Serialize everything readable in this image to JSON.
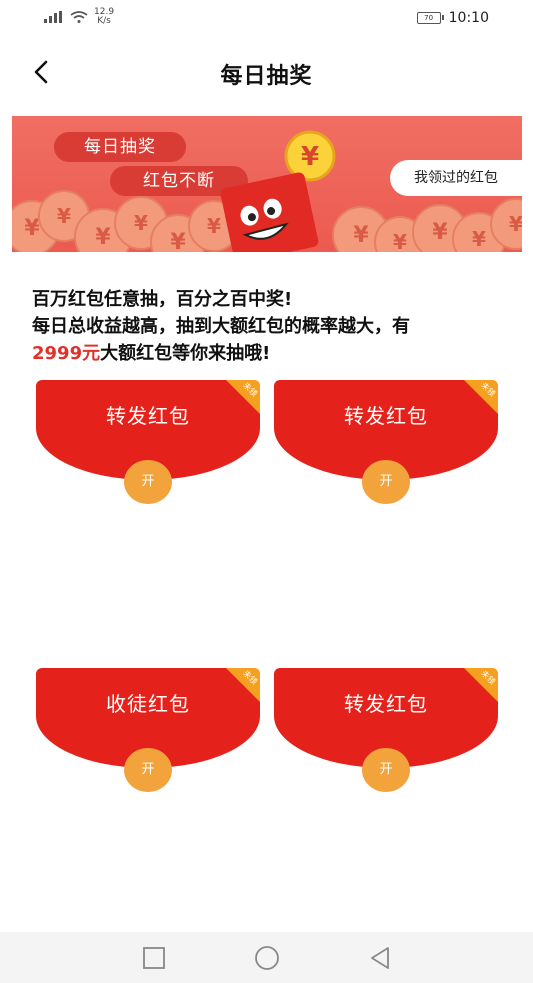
{
  "status_bar": {
    "signal_text": "⁴⁶",
    "net_speed": "12.9",
    "net_unit": "K/s",
    "battery": "70",
    "time": "10:10"
  },
  "header": {
    "title": "每日抽奖"
  },
  "banner": {
    "pill_1": "每日抽奖",
    "pill_2": "红包不断",
    "my_packets_button": "我领过的红包",
    "coin_symbol": "¥"
  },
  "promo": {
    "line1": "百万红包任意抽，百分之百中奖!",
    "line2": "每日总收益越高，抽到大额红包的概率越大，有",
    "amount": "2999元",
    "line3_rest": "大额红包等你来抽哦!"
  },
  "packets": [
    {
      "label": "转发红包",
      "badge": "未领",
      "open": "开"
    },
    {
      "label": "转发红包",
      "badge": "未领",
      "open": "开"
    },
    {
      "label": "收徒红包",
      "badge": "未领",
      "open": "开"
    },
    {
      "label": "转发红包",
      "badge": "未领",
      "open": "开"
    }
  ],
  "colors": {
    "packet_red": "#e4221b",
    "open_orange": "#f2a33b",
    "badge_orange": "#f5a021",
    "amount_red": "#e0312a",
    "banner_red": "#ec5a50"
  }
}
